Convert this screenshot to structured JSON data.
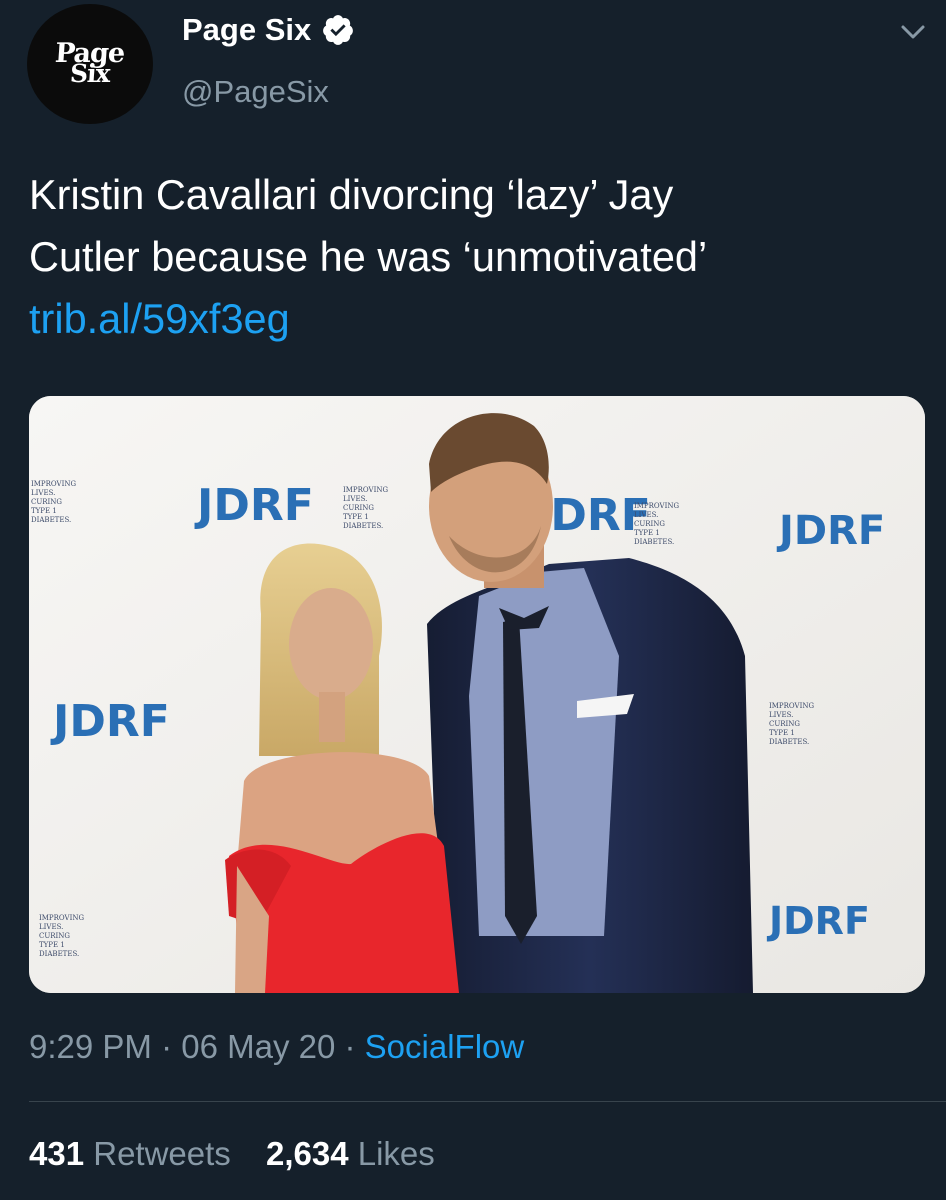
{
  "account": {
    "avatar_line1": "Page",
    "avatar_line2": "Six",
    "display_name": "Page Six",
    "handle": "@PageSix",
    "verified_icon": "verified-badge-icon"
  },
  "tweet": {
    "text_line1": "Kristin Cavallari divorcing ‘lazy’ Jay",
    "text_line2": "Cutler because he was ‘unmotivated’",
    "link": "trib.al/59xf3eg"
  },
  "media": {
    "backdrop_logo": "JDRF",
    "backdrop_tagline": [
      "IMPROVING",
      "LIVES.",
      "CURING",
      "TYPE 1",
      "DIABETES."
    ],
    "colors": {
      "backdrop": "#f4f3f1",
      "logo_blue": "#2a6fb5",
      "dress_red": "#e8262c",
      "suit_navy": "#1d2640"
    }
  },
  "meta": {
    "time": "9:29 PM",
    "separator": " · ",
    "date": "06 May 20",
    "source": "SocialFlow"
  },
  "stats": {
    "retweets_count": "431",
    "retweets_label": "Retweets",
    "likes_count": "2,634",
    "likes_label": "Likes"
  },
  "colors": {
    "background": "#15202b",
    "text_primary": "#ffffff",
    "text_secondary": "#8899a6",
    "accent": "#1da1f2",
    "divider": "#38444d"
  }
}
